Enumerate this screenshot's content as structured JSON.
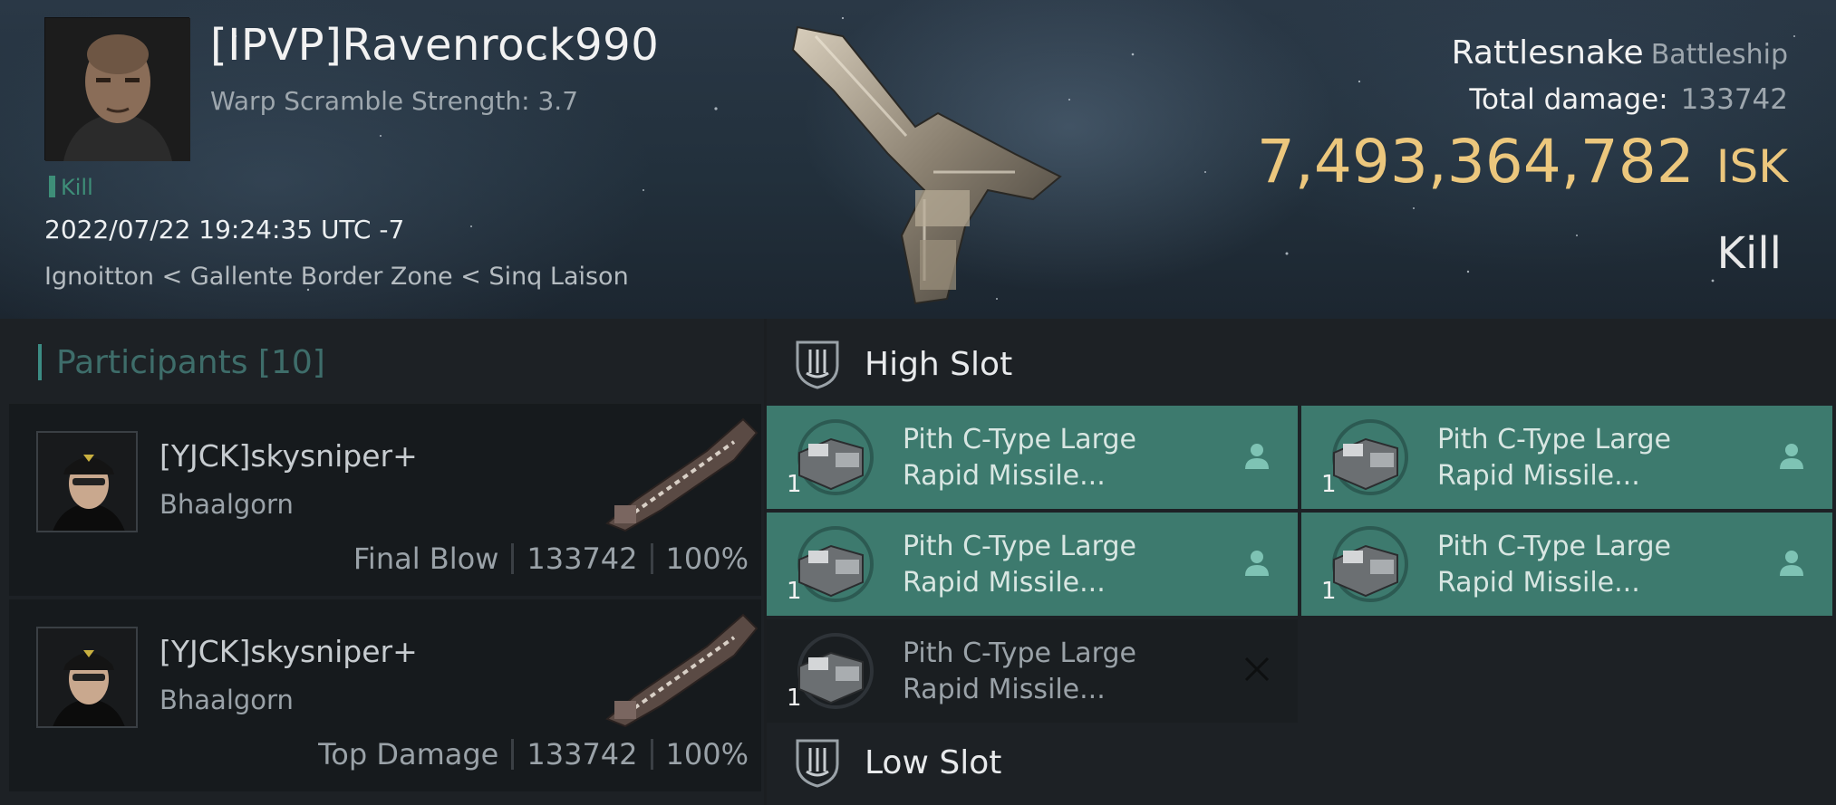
{
  "header": {
    "pilot_name": "[IPVP]Ravenrock990",
    "warp_scramble": "Warp Scramble Strength: 3.7",
    "kill_tag": "Kill",
    "datetime": "2022/07/22 19:24:35 UTC -7",
    "location": "Ignoitton < Gallente Border Zone < Sinq Laison",
    "ship_name": "Rattlesnake",
    "ship_class": "Battleship",
    "total_damage_label": "Total damage:",
    "total_damage_value": "133742",
    "isk_value": "7,493,364,782",
    "isk_unit": "ISK",
    "result": "Kill",
    "icons": {
      "portrait": "pilot-portrait",
      "ship": "ship-render"
    }
  },
  "participants": {
    "title": "Participants",
    "count": "[10]",
    "rows": [
      {
        "name": "[YJCK]skysniper+",
        "ship": "Bhaalgorn",
        "role": "Final Blow",
        "damage": "133742",
        "percent": "100%"
      },
      {
        "name": "[YJCK]skysniper+",
        "ship": "Bhaalgorn",
        "role": "Top Damage",
        "damage": "133742",
        "percent": "100%"
      }
    ]
  },
  "slots": {
    "high_title": "High Slot",
    "low_title": "Low Slot",
    "high_modules": [
      {
        "line1": "Pith C-Type Large",
        "line2": "Rapid Missile...",
        "qty": "1",
        "status": "dropped-icon"
      },
      {
        "line1": "Pith C-Type Large",
        "line2": "Rapid Missile...",
        "qty": "1",
        "status": "dropped-icon"
      },
      {
        "line1": "Pith C-Type Large",
        "line2": "Rapid Missile...",
        "qty": "1",
        "status": "dropped-icon"
      },
      {
        "line1": "Pith C-Type Large",
        "line2": "Rapid Missile...",
        "qty": "1",
        "status": "dropped-icon"
      },
      {
        "line1": "Pith C-Type Large",
        "line2": "Rapid Missile...",
        "qty": "1",
        "status": "destroyed-icon"
      }
    ]
  },
  "colors": {
    "isk": "#ecc77d",
    "dropped": "#3d7a6e",
    "kill_accent": "#3e8e78"
  }
}
